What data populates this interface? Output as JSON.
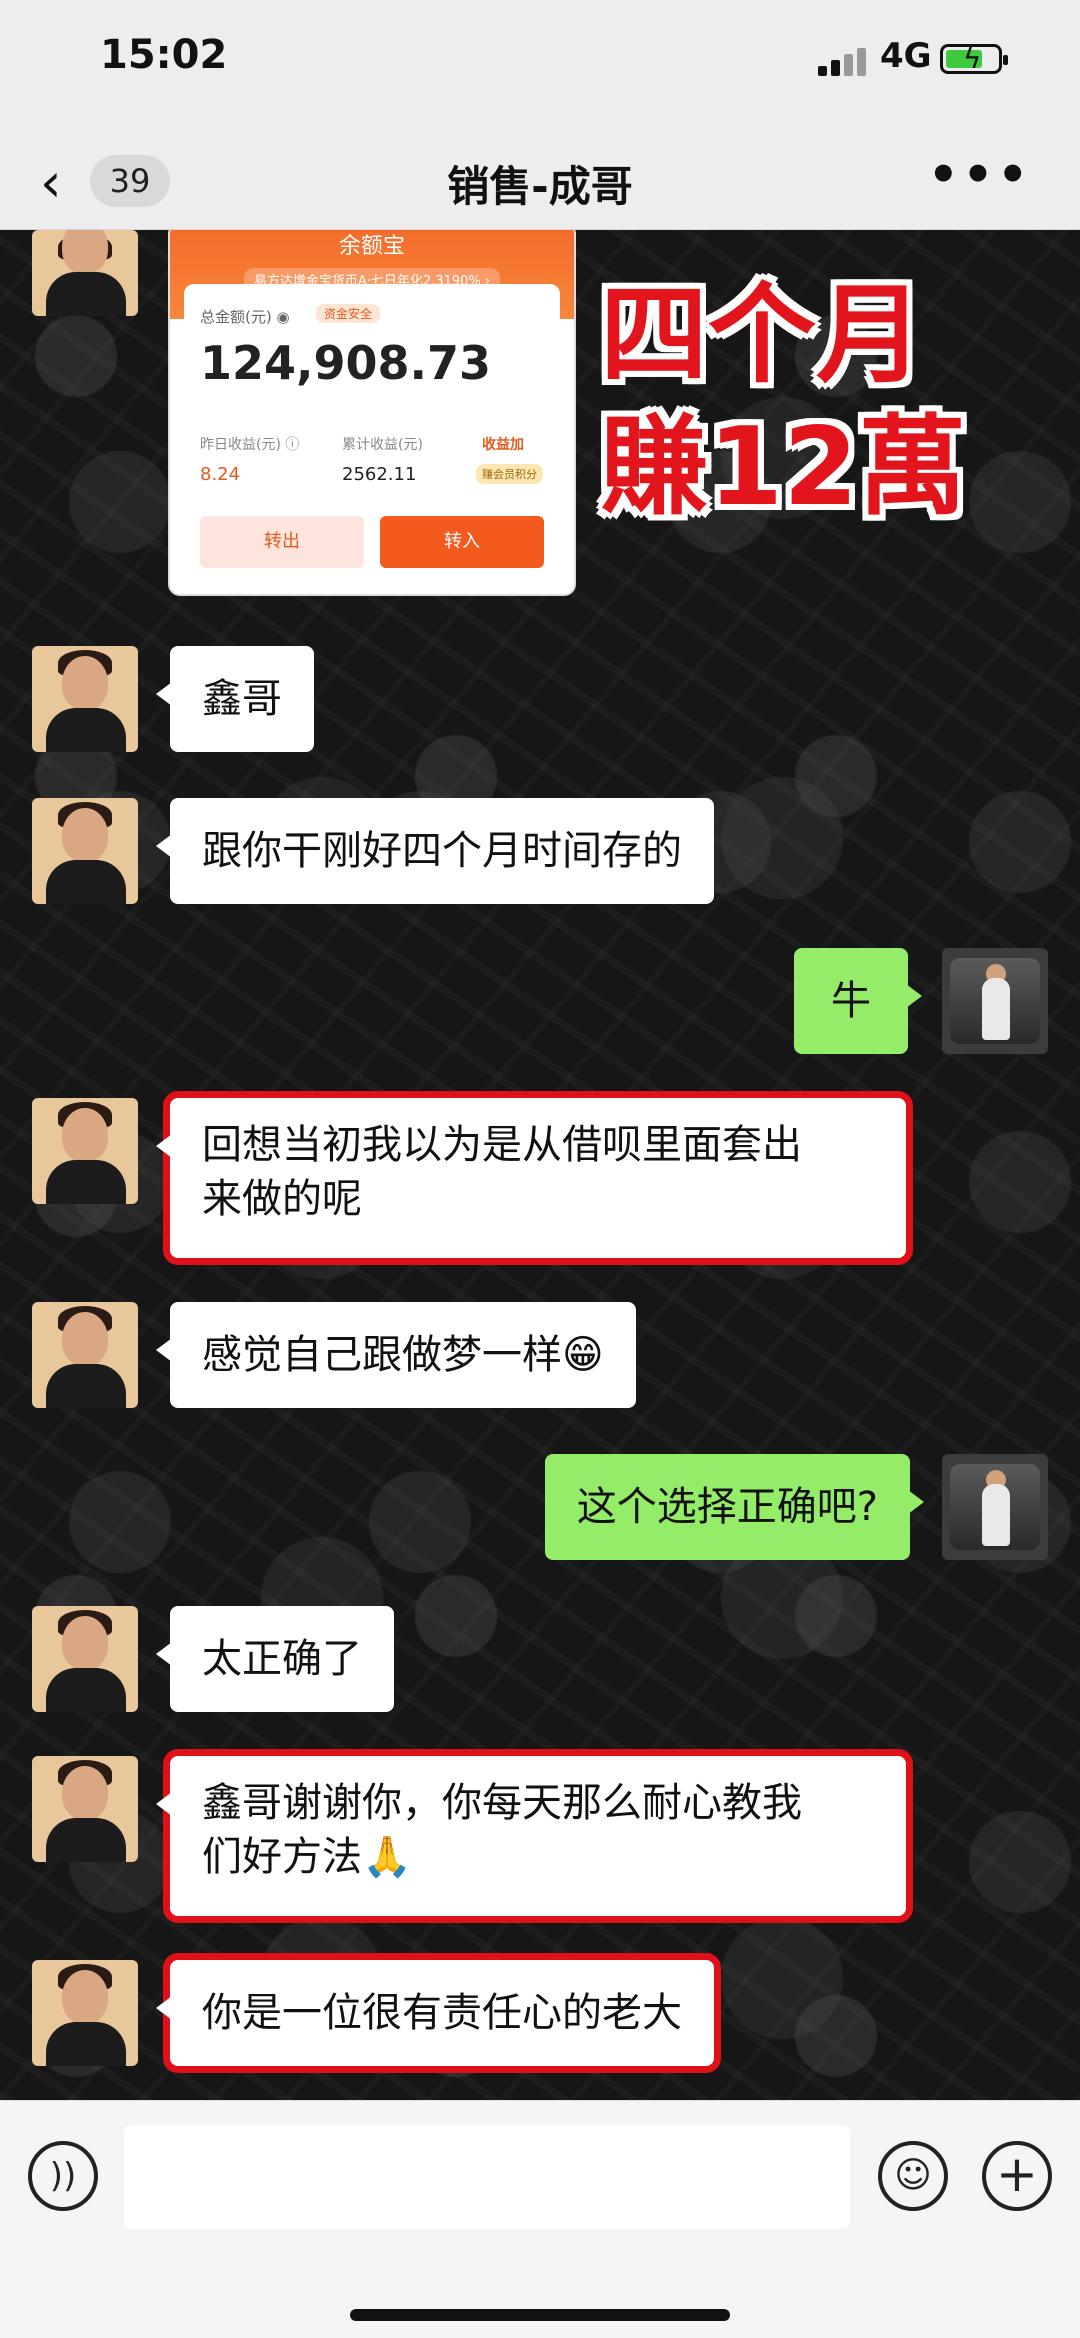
{
  "status_bar": {
    "time": "15:02",
    "network": "4G"
  },
  "header": {
    "back_icon": "‹",
    "unread_count": "39",
    "title": "销售-成哥",
    "more_icon": "•••"
  },
  "card": {
    "title": "余额宝",
    "subtitle": "易方达增金宝货币A·七日年化2.3190% ›",
    "total_label": "总金额(元) ◉",
    "safe_tag": "资金安全",
    "total_value": "124,908.73",
    "yesterday_label": "昨日收益(元) ⓘ",
    "yesterday_value": "8.24",
    "cumulative_label": "累计收益(元)",
    "cumulative_value": "2562.11",
    "promo_label": "收益加",
    "promo_tag": "赚会员积分",
    "btn_out": "转出",
    "btn_in": "转入"
  },
  "overlay": {
    "line1": "四个月",
    "line2": "賺12萬"
  },
  "messages": [
    {
      "from": "other",
      "text": "鑫哥",
      "highlight": false
    },
    {
      "from": "other",
      "text": "跟你干刚好四个月时间存的",
      "highlight": false
    },
    {
      "from": "me",
      "text": "牛",
      "highlight": false
    },
    {
      "from": "other",
      "text": "回想当初我以为是从借呗里面套出来做的呢",
      "line1": "回想当初我以为是从借呗里面套出",
      "line2": "来做的呢",
      "highlight": true
    },
    {
      "from": "other",
      "text": "感觉自己跟做梦一样😁",
      "highlight": false
    },
    {
      "from": "me",
      "text": "这个选择正确吧?",
      "highlight": false
    },
    {
      "from": "other",
      "text": "太正确了",
      "highlight": false
    },
    {
      "from": "other",
      "text": "鑫哥谢谢你，你每天那么耐心教我们好方法🙏",
      "line1": "鑫哥谢谢你，你每天那么耐心教我",
      "line2": "们好方法🙏",
      "highlight": true
    },
    {
      "from": "other",
      "text": "你是一位很有责任心的老大",
      "highlight": true
    }
  ],
  "input_bar": {
    "voice_icon": "voice-icon",
    "emoji_icon": "emoji-icon",
    "plus_icon": "plus-icon"
  },
  "colors": {
    "header_bg": "#ededed",
    "green_bubble": "#95ec69",
    "highlight_red": "#e0101a"
  }
}
